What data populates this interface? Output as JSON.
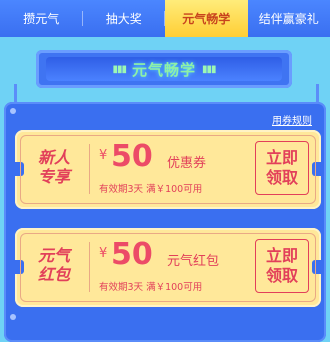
{
  "tabs": [
    {
      "label": "攒元气",
      "active": false
    },
    {
      "label": "抽大奖",
      "active": false
    },
    {
      "label": "元气畅学",
      "active": true
    },
    {
      "label": "结伴赢豪礼",
      "active": false
    }
  ],
  "section_title": "元气畅学",
  "rules_link": "用券规则",
  "coupons": [
    {
      "badge_line1": "新人",
      "badge_line2": "专享",
      "currency": "¥",
      "amount": "50",
      "type": "优惠券",
      "condition": "有效期3天 满￥100可用",
      "claim_line1": "立即",
      "claim_line2": "领取"
    },
    {
      "badge_line1": "元气",
      "badge_line2": "红包",
      "currency": "¥",
      "amount": "50",
      "type": "元气红包",
      "condition": "有效期3天 满￥100可用",
      "claim_line1": "立即",
      "claim_line2": "领取"
    }
  ],
  "colors": {
    "tab_bar": "#3a6ff0",
    "active_tab": "#ffd84a",
    "background": "#6fd2f5",
    "coupon": "#ffe89a",
    "accent_red": "#e2405a"
  }
}
